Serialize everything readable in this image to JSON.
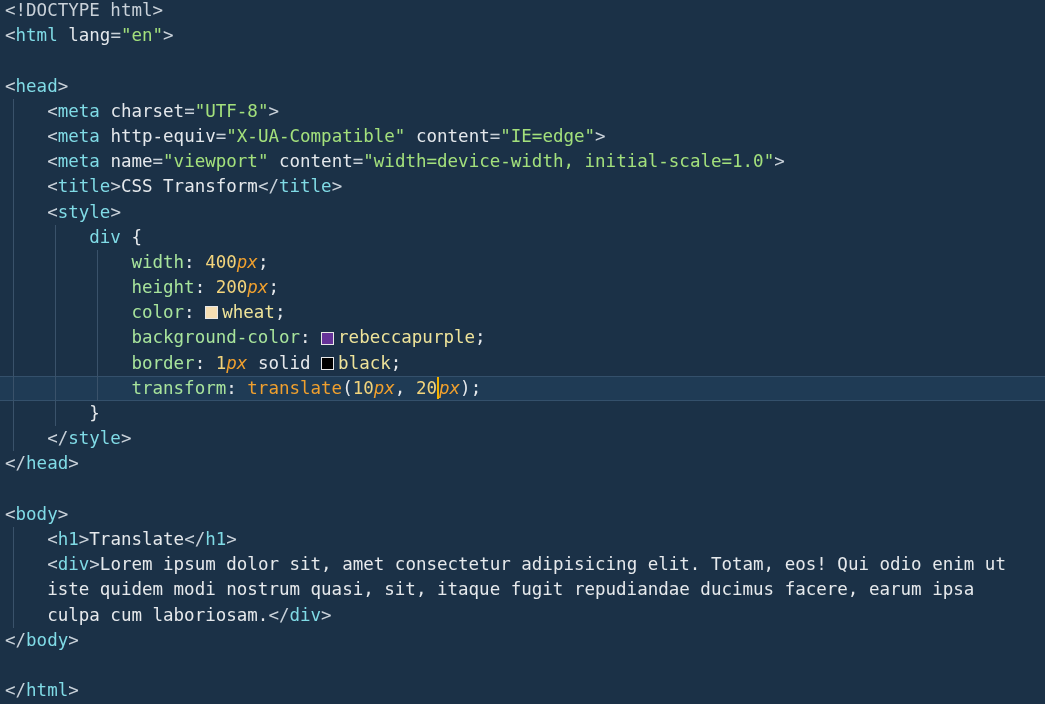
{
  "lines": [
    {
      "kind": "code",
      "current": false,
      "tokens": [
        {
          "kind": "punct",
          "text": "<!DOCTYPE html>"
        }
      ]
    },
    {
      "kind": "code",
      "current": false,
      "tokens": [
        {
          "kind": "punct",
          "text": "<"
        },
        {
          "kind": "tag",
          "text": "html"
        },
        {
          "kind": "attr",
          "text": " lang"
        },
        {
          "kind": "punct",
          "text": "="
        },
        {
          "kind": "string",
          "text": "\"en\""
        },
        {
          "kind": "punct",
          "text": ">"
        }
      ]
    },
    {
      "kind": "blank",
      "current": false
    },
    {
      "kind": "code",
      "current": false,
      "tokens": [
        {
          "kind": "punct",
          "text": "<"
        },
        {
          "kind": "tag",
          "text": "head"
        },
        {
          "kind": "punct",
          "text": ">"
        }
      ],
      "children": [
        {
          "kind": "code",
          "current": false,
          "tokens": [
            {
              "kind": "punct",
              "text": "<"
            },
            {
              "kind": "tag",
              "text": "meta"
            },
            {
              "kind": "attr",
              "text": " charset"
            },
            {
              "kind": "punct",
              "text": "="
            },
            {
              "kind": "string",
              "text": "\"UTF-8\""
            },
            {
              "kind": "punct",
              "text": ">"
            }
          ]
        },
        {
          "kind": "code",
          "current": false,
          "tokens": [
            {
              "kind": "punct",
              "text": "<"
            },
            {
              "kind": "tag",
              "text": "meta"
            },
            {
              "kind": "attr",
              "text": " http-equiv"
            },
            {
              "kind": "punct",
              "text": "="
            },
            {
              "kind": "string",
              "text": "\"X-UA-Compatible\""
            },
            {
              "kind": "attr",
              "text": " content"
            },
            {
              "kind": "punct",
              "text": "="
            },
            {
              "kind": "string",
              "text": "\"IE=edge\""
            },
            {
              "kind": "punct",
              "text": ">"
            }
          ]
        },
        {
          "kind": "code",
          "current": false,
          "tokens": [
            {
              "kind": "punct",
              "text": "<"
            },
            {
              "kind": "tag",
              "text": "meta"
            },
            {
              "kind": "attr",
              "text": " name"
            },
            {
              "kind": "punct",
              "text": "="
            },
            {
              "kind": "string",
              "text": "\"viewport\""
            },
            {
              "kind": "attr",
              "text": " content"
            },
            {
              "kind": "punct",
              "text": "="
            },
            {
              "kind": "string",
              "text": "\"width=device-width, initial-scale=1.0\""
            },
            {
              "kind": "punct",
              "text": ">"
            }
          ]
        },
        {
          "kind": "code",
          "current": false,
          "tokens": [
            {
              "kind": "punct",
              "text": "<"
            },
            {
              "kind": "tag",
              "text": "title"
            },
            {
              "kind": "punct",
              "text": ">"
            },
            {
              "kind": "text",
              "text": "CSS Transform"
            },
            {
              "kind": "punct",
              "text": "</"
            },
            {
              "kind": "tag",
              "text": "title"
            },
            {
              "kind": "punct",
              "text": ">"
            }
          ]
        },
        {
          "kind": "code",
          "current": false,
          "tokens": [
            {
              "kind": "punct",
              "text": "<"
            },
            {
              "kind": "tag",
              "text": "style"
            },
            {
              "kind": "punct",
              "text": ">"
            }
          ],
          "children": [
            {
              "kind": "code",
              "current": false,
              "tokens": [
                {
                  "kind": "selector",
                  "text": "div"
                },
                {
                  "kind": "text",
                  "text": " {"
                }
              ],
              "children": [
                {
                  "kind": "code",
                  "current": false,
                  "tokens": [
                    {
                      "kind": "prop",
                      "text": "width"
                    },
                    {
                      "kind": "text",
                      "text": ": "
                    },
                    {
                      "kind": "number",
                      "text": "400"
                    },
                    {
                      "kind": "unit",
                      "text": "px"
                    },
                    {
                      "kind": "text",
                      "text": ";"
                    }
                  ]
                },
                {
                  "kind": "code",
                  "current": false,
                  "tokens": [
                    {
                      "kind": "prop",
                      "text": "height"
                    },
                    {
                      "kind": "text",
                      "text": ": "
                    },
                    {
                      "kind": "number",
                      "text": "200"
                    },
                    {
                      "kind": "unit",
                      "text": "px"
                    },
                    {
                      "kind": "text",
                      "text": ";"
                    }
                  ]
                },
                {
                  "kind": "code",
                  "current": false,
                  "tokens": [
                    {
                      "kind": "prop",
                      "text": "color"
                    },
                    {
                      "kind": "text",
                      "text": ": "
                    },
                    {
                      "kind": "swatch",
                      "color": "#f5deb3"
                    },
                    {
                      "kind": "value",
                      "text": "wheat"
                    },
                    {
                      "kind": "text",
                      "text": ";"
                    }
                  ]
                },
                {
                  "kind": "code",
                  "current": false,
                  "tokens": [
                    {
                      "kind": "prop",
                      "text": "background-color"
                    },
                    {
                      "kind": "text",
                      "text": ": "
                    },
                    {
                      "kind": "swatch",
                      "color": "#663399"
                    },
                    {
                      "kind": "value",
                      "text": "rebeccapurple"
                    },
                    {
                      "kind": "text",
                      "text": ";"
                    }
                  ]
                },
                {
                  "kind": "code",
                  "current": false,
                  "tokens": [
                    {
                      "kind": "prop",
                      "text": "border"
                    },
                    {
                      "kind": "text",
                      "text": ": "
                    },
                    {
                      "kind": "number",
                      "text": "1"
                    },
                    {
                      "kind": "unit",
                      "text": "px"
                    },
                    {
                      "kind": "text",
                      "text": " solid "
                    },
                    {
                      "kind": "swatch",
                      "color": "#000000"
                    },
                    {
                      "kind": "value",
                      "text": "black"
                    },
                    {
                      "kind": "text",
                      "text": ";"
                    }
                  ]
                },
                {
                  "kind": "code",
                  "current": true,
                  "tokens": [
                    {
                      "kind": "prop",
                      "text": "transform"
                    },
                    {
                      "kind": "text",
                      "text": ": "
                    },
                    {
                      "kind": "func",
                      "text": "translate"
                    },
                    {
                      "kind": "text",
                      "text": "("
                    },
                    {
                      "kind": "number",
                      "text": "10"
                    },
                    {
                      "kind": "unit",
                      "text": "px"
                    },
                    {
                      "kind": "text",
                      "text": ", "
                    },
                    {
                      "kind": "number",
                      "text": "20"
                    },
                    {
                      "kind": "caret"
                    },
                    {
                      "kind": "unit",
                      "text": "px"
                    },
                    {
                      "kind": "text",
                      "text": ");"
                    }
                  ]
                }
              ]
            },
            {
              "kind": "code",
              "current": false,
              "tokens": [
                {
                  "kind": "text",
                  "text": "}"
                }
              ]
            }
          ]
        },
        {
          "kind": "code",
          "current": false,
          "tokens": [
            {
              "kind": "punct",
              "text": "</"
            },
            {
              "kind": "tag",
              "text": "style"
            },
            {
              "kind": "punct",
              "text": ">"
            }
          ]
        }
      ]
    },
    {
      "kind": "code",
      "current": false,
      "tokens": [
        {
          "kind": "punct",
          "text": "</"
        },
        {
          "kind": "tag",
          "text": "head"
        },
        {
          "kind": "punct",
          "text": ">"
        }
      ]
    },
    {
      "kind": "blank",
      "current": false
    },
    {
      "kind": "code",
      "current": false,
      "tokens": [
        {
          "kind": "punct",
          "text": "<"
        },
        {
          "kind": "tag",
          "text": "body"
        },
        {
          "kind": "punct",
          "text": ">"
        }
      ],
      "children": [
        {
          "kind": "code",
          "current": false,
          "tokens": [
            {
              "kind": "punct",
              "text": "<"
            },
            {
              "kind": "tag",
              "text": "h1"
            },
            {
              "kind": "punct",
              "text": ">"
            },
            {
              "kind": "text",
              "text": "Translate"
            },
            {
              "kind": "punct",
              "text": "</"
            },
            {
              "kind": "tag",
              "text": "h1"
            },
            {
              "kind": "punct",
              "text": ">"
            }
          ]
        },
        {
          "kind": "code",
          "current": false,
          "tokens": [
            {
              "kind": "punct",
              "text": "<"
            },
            {
              "kind": "tag",
              "text": "div"
            },
            {
              "kind": "punct",
              "text": ">"
            },
            {
              "kind": "text",
              "text": "Lorem ipsum dolor sit, amet consectetur adipisicing elit. Totam, eos! Qui odio enim ut"
            }
          ]
        },
        {
          "kind": "code",
          "current": false,
          "tokens": [
            {
              "kind": "text",
              "text": "iste quidem modi nostrum quasi, sit, itaque fugit repudiandae ducimus facere, earum ipsa"
            }
          ]
        },
        {
          "kind": "code",
          "current": false,
          "tokens": [
            {
              "kind": "text",
              "text": "culpa cum laboriosam."
            },
            {
              "kind": "punct",
              "text": "</"
            },
            {
              "kind": "tag",
              "text": "div"
            },
            {
              "kind": "punct",
              "text": ">"
            }
          ]
        }
      ]
    },
    {
      "kind": "code",
      "current": false,
      "tokens": [
        {
          "kind": "punct",
          "text": "</"
        },
        {
          "kind": "tag",
          "text": "body"
        },
        {
          "kind": "punct",
          "text": ">"
        }
      ]
    },
    {
      "kind": "blank",
      "current": false
    },
    {
      "kind": "code",
      "current": false,
      "tokens": [
        {
          "kind": "punct",
          "text": "</"
        },
        {
          "kind": "tag",
          "text": "html"
        },
        {
          "kind": "punct",
          "text": ">"
        }
      ]
    }
  ]
}
